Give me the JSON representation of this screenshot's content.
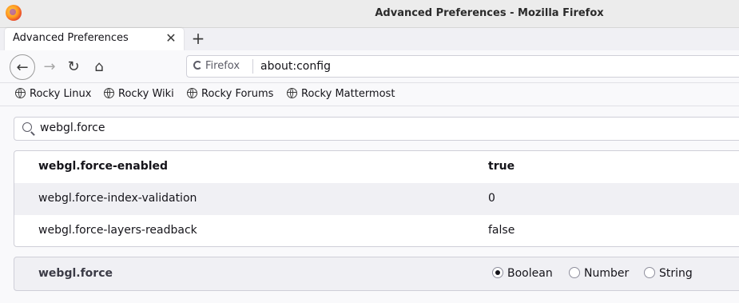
{
  "window": {
    "title": "Advanced Preferences - Mozilla Firefox"
  },
  "tab": {
    "title": "Advanced Preferences",
    "close_glyph": "✕",
    "new_tab_glyph": "+"
  },
  "nav": {
    "back_glyph": "←",
    "forward_glyph": "→",
    "reload_glyph": "↻",
    "home_glyph": "⌂"
  },
  "urlbar": {
    "identity_label": "Firefox",
    "url": "about:config"
  },
  "bookmarks": [
    {
      "label": "Rocky Linux"
    },
    {
      "label": "Rocky Wiki"
    },
    {
      "label": "Rocky Forums"
    },
    {
      "label": "Rocky Mattermost"
    }
  ],
  "search": {
    "value": "webgl.force"
  },
  "prefs": [
    {
      "name": "webgl.force-enabled",
      "value": "true",
      "modified": true
    },
    {
      "name": "webgl.force-index-validation",
      "value": "0",
      "modified": false
    },
    {
      "name": "webgl.force-layers-readback",
      "value": "false",
      "modified": false
    }
  ],
  "new_pref": {
    "name": "webgl.force",
    "types": [
      {
        "label": "Boolean",
        "checked": true
      },
      {
        "label": "Number",
        "checked": false
      },
      {
        "label": "String",
        "checked": false
      }
    ]
  },
  "icons": {
    "app": "firefox-logo-icon",
    "search": "search-icon",
    "bookmark": "globe-icon"
  }
}
